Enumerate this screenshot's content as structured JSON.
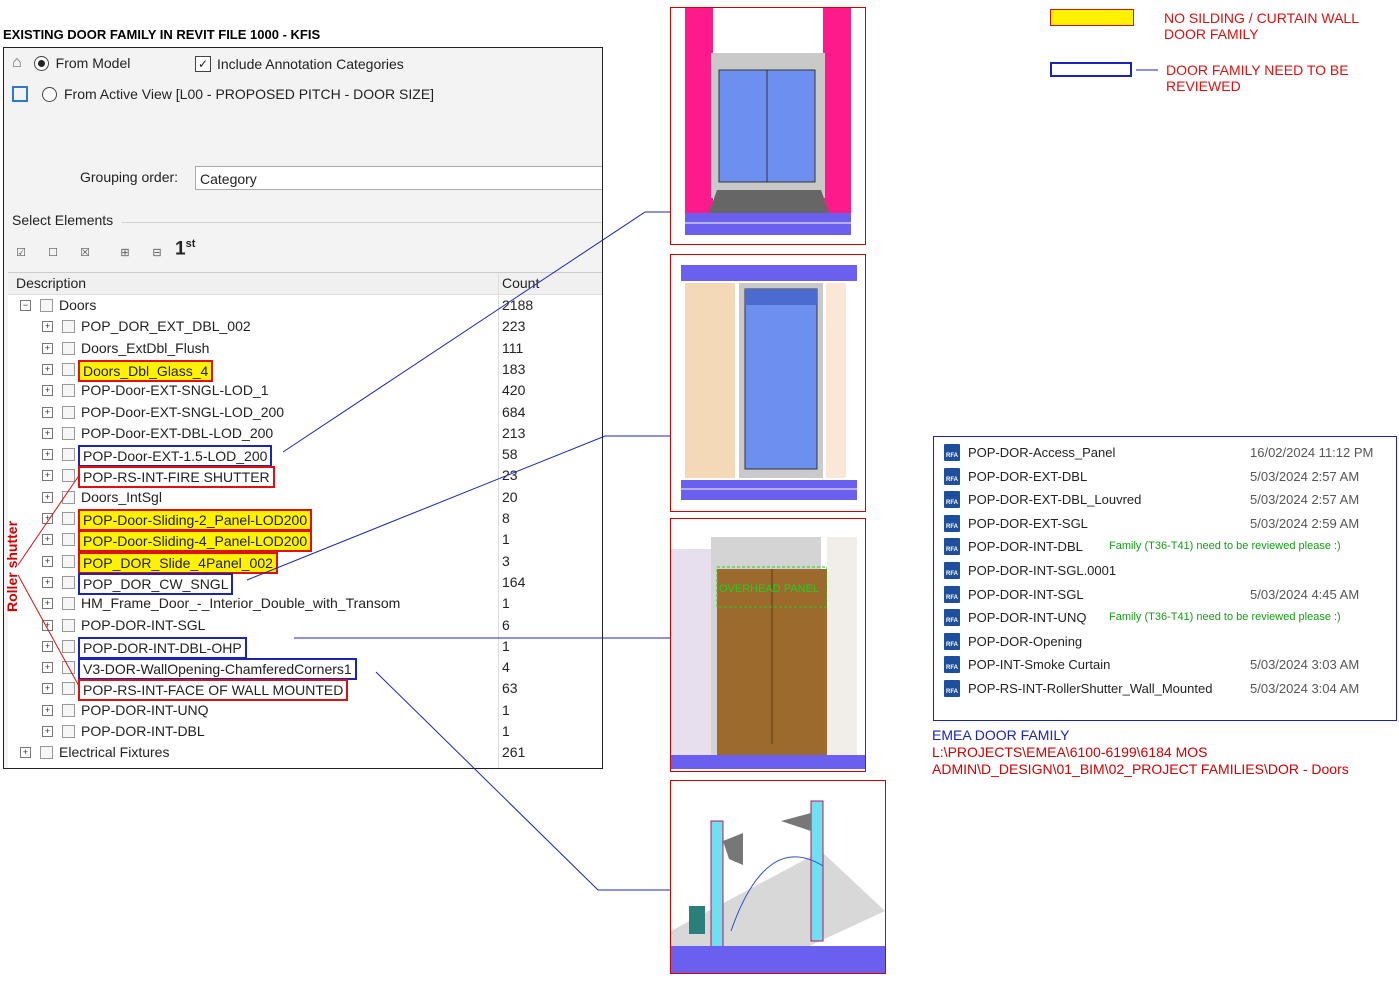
{
  "title": "EXISTING DOOR FAMILY IN REVIT FILE 1000 - KFIS",
  "dialog": {
    "from_model": "From Model",
    "include_annotation": "Include Annotation Categories",
    "from_active_view": "From Active View [L00 - PROPOSED PITCH - DOOR SIZE]",
    "grouping_label": "Grouping order:",
    "grouping_value": "Category",
    "select_elements": "Select Elements",
    "first_label": "1",
    "first_sup": "st",
    "col_description": "Description",
    "col_count": "Count",
    "tree": [
      {
        "name": "Doors",
        "count": "2188",
        "level": 0,
        "highlight": "none"
      },
      {
        "name": "POP_DOR_EXT_DBL_002",
        "count": "223",
        "level": 1,
        "highlight": "none"
      },
      {
        "name": "Doors_ExtDbl_Flush",
        "count": "111",
        "level": 1,
        "highlight": "none"
      },
      {
        "name": "Doors_Dbl_Glass_4",
        "count": "183",
        "level": 1,
        "highlight": "yellow"
      },
      {
        "name": "POP-Door-EXT-SNGL-LOD_1",
        "count": "420",
        "level": 1,
        "highlight": "none"
      },
      {
        "name": "POP-Door-EXT-SNGL-LOD_200",
        "count": "684",
        "level": 1,
        "highlight": "none"
      },
      {
        "name": "POP-Door-EXT-DBL-LOD_200",
        "count": "213",
        "level": 1,
        "highlight": "none"
      },
      {
        "name": "POP-Door-EXT-1.5-LOD_200",
        "count": "58",
        "level": 1,
        "highlight": "blue"
      },
      {
        "name": "POP-RS-INT-FIRE SHUTTER",
        "count": "23",
        "level": 1,
        "highlight": "red"
      },
      {
        "name": "Doors_IntSgl",
        "count": "20",
        "level": 1,
        "highlight": "none"
      },
      {
        "name": "POP-Door-Sliding-2_Panel-LOD200",
        "count": "8",
        "level": 1,
        "highlight": "yellow"
      },
      {
        "name": "POP-Door-Sliding-4_Panel-LOD200",
        "count": "1",
        "level": 1,
        "highlight": "yellow"
      },
      {
        "name": "POP_DOR_Slide_4Panel_002",
        "count": "3",
        "level": 1,
        "highlight": "yellow"
      },
      {
        "name": "POP_DOR_CW_SNGL",
        "count": "164",
        "level": 1,
        "highlight": "blue"
      },
      {
        "name": "HM_Frame_Door_-_Interior_Double_with_Transom",
        "count": "1",
        "level": 1,
        "highlight": "none"
      },
      {
        "name": "POP-DOR-INT-SGL",
        "count": "6",
        "level": 1,
        "highlight": "none"
      },
      {
        "name": "POP-DOR-INT-DBL-OHP",
        "count": "1",
        "level": 1,
        "highlight": "blue"
      },
      {
        "name": "V3-DOR-WallOpening-ChamferedCorners1",
        "count": "4",
        "level": 1,
        "highlight": "blue"
      },
      {
        "name": "POP-RS-INT-FACE OF WALL MOUNTED",
        "count": "63",
        "level": 1,
        "highlight": "red"
      },
      {
        "name": "POP-DOR-INT-UNQ",
        "count": "1",
        "level": 1,
        "highlight": "none"
      },
      {
        "name": "POP-DOR-INT-DBL",
        "count": "1",
        "level": 1,
        "highlight": "none"
      },
      {
        "name": "Electrical Fixtures",
        "count": "261",
        "level": 0,
        "highlight": "none"
      }
    ]
  },
  "roller_shutter_label": "Roller shutter",
  "overhead_panel_label": "OVERHEAD PANEL",
  "legend": {
    "yellow_text_1": "NO SILDING / CURTAIN WALL",
    "yellow_text_2": "DOOR FAMILY",
    "blue_text_1": "DOOR FAMILY NEED TO BE",
    "blue_text_2": "REVIEWED"
  },
  "files": [
    {
      "name": "POP-DOR-Access_Panel",
      "date": "16/02/2024 11:12 PM",
      "note": ""
    },
    {
      "name": "POP-DOR-EXT-DBL",
      "date": "5/03/2024 2:57 AM",
      "note": ""
    },
    {
      "name": "POP-DOR-EXT-DBL_Louvred",
      "date": "5/03/2024 2:57 AM",
      "note": ""
    },
    {
      "name": "POP-DOR-EXT-SGL",
      "date": "5/03/2024 2:59 AM",
      "note": ""
    },
    {
      "name": "POP-DOR-INT-DBL",
      "date": "",
      "note": "Family (T36-T41) need to be reviewed please :)"
    },
    {
      "name": "POP-DOR-INT-SGL.0001",
      "date": "",
      "note": ""
    },
    {
      "name": "POP-DOR-INT-SGL",
      "date": "5/03/2024 4:45 AM",
      "note": ""
    },
    {
      "name": "POP-DOR-INT-UNQ",
      "date": "",
      "note": "Family (T36-T41) need to be reviewed please :)"
    },
    {
      "name": "POP-DOR-Opening",
      "date": "",
      "note": ""
    },
    {
      "name": "POP-INT-Smoke Curtain",
      "date": "5/03/2024 3:03 AM",
      "note": ""
    },
    {
      "name": "POP-RS-INT-RollerShutter_Wall_Mounted",
      "date": "5/03/2024 3:04 AM",
      "note": ""
    }
  ],
  "path": {
    "title": "EMEA DOOR FAMILY",
    "line1": "L:\\PROJECTS\\EMEA\\6100-6199\\6184 MOS",
    "line2": "ADMIN\\D_DESIGN\\01_BIM\\02_PROJECT FAMILIES\\DOR - Doors"
  },
  "colors": {
    "highlight_yellow": "#fff200",
    "review_blue": "#1a24b8",
    "accent_red": "#e01010",
    "note_green": "#14a014"
  }
}
